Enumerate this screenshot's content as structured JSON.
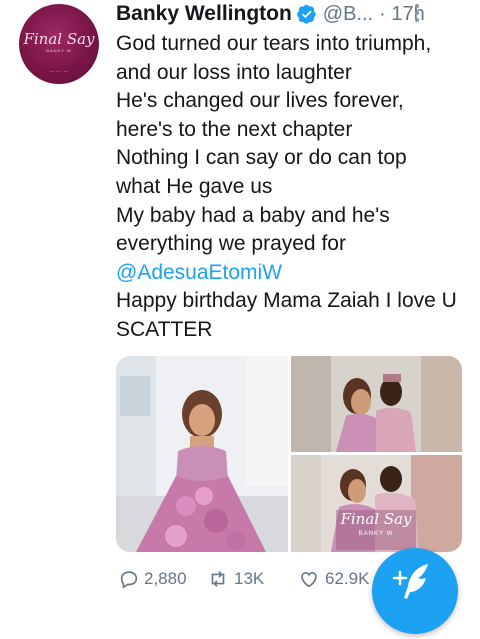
{
  "author": {
    "name": "Banky Wellington",
    "handle": "@B...",
    "time": "· 17h",
    "avatar_text": "Final Say",
    "avatar_sub": "BANKY W"
  },
  "tweet": {
    "lines": [
      "God turned our tears into triumph,",
      "and our loss into laughter",
      "He's changed our lives forever,",
      "here's to the next chapter",
      "Nothing I can say or do can top",
      "what He gave us",
      "My baby had a baby and he's",
      "everything we prayed for"
    ],
    "mention": "@AdesuaEtomiW",
    "closing_lines": [
      "Happy birthday Mama Zaiah I love U",
      "SCATTER"
    ]
  },
  "media": {
    "watermark_title": "Final Say",
    "watermark_sub": "BANKY W"
  },
  "actions": {
    "replies": "2,880",
    "retweets": "13K",
    "likes": "62.9K"
  },
  "colors": {
    "accent": "#1da1f2",
    "muted": "#657786",
    "text": "#14171a"
  }
}
